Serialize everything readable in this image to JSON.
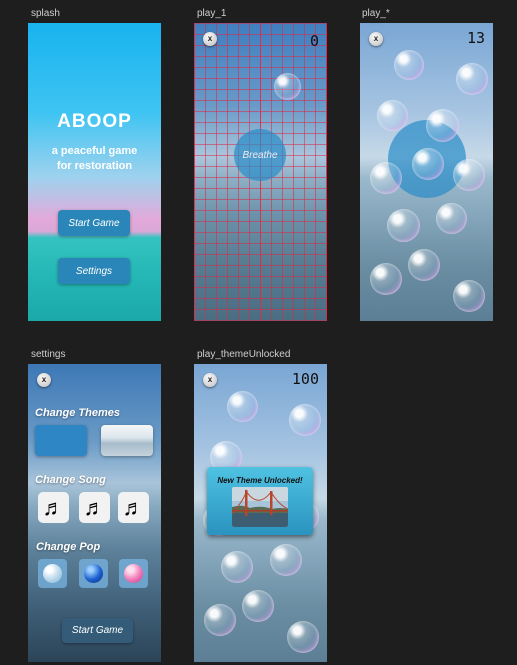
{
  "labels": {
    "splash": "splash",
    "play_1": "play_1",
    "play_star": "play_*",
    "settings": "settings",
    "play_themeUnlocked": "play_themeUnlocked"
  },
  "splash": {
    "title": "ABOOP",
    "subtitle": "a peaceful game\nfor restoration",
    "start_button": "Start Game",
    "settings_button": "Settings"
  },
  "play_1": {
    "close": "x",
    "score": "0",
    "breathe": "Breathe"
  },
  "play_star": {
    "close": "x",
    "score": "13"
  },
  "settings": {
    "close": "x",
    "themes_title": "Change Themes",
    "song_title": "Change Song",
    "pop_title": "Change Pop",
    "start_button": "Start Game",
    "note_icon": "♬"
  },
  "play_themeUnlocked": {
    "close": "x",
    "score": "100",
    "dialog_title": "New Theme Unlocked!"
  },
  "colors": {
    "accent_button": "#2a86b8",
    "breathe_circle": "#2a8cc8",
    "pop_blue": "#1a5fcf",
    "pop_pink": "#f07ab8"
  }
}
